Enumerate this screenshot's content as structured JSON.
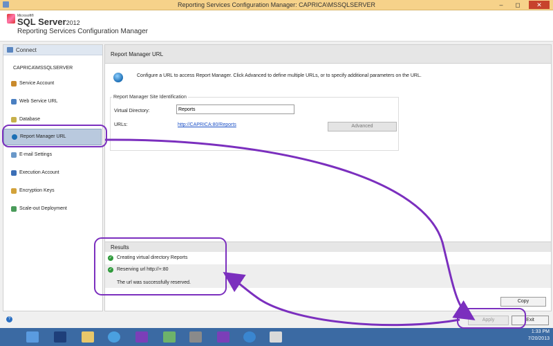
{
  "window": {
    "title": "Reporting Services Configuration Manager: CAPRICA\\MSSQLSERVER",
    "minimize": "–",
    "maximize": "◻",
    "close": "✕"
  },
  "header": {
    "ms_logo": "Microsoft®",
    "sql_server": "SQL Server",
    "sql_version": "2012",
    "product": "Reporting Services Configuration Manager"
  },
  "sidebar": {
    "connect_label": "Connect",
    "instance": "CAPRICA\\MSSQLSERVER",
    "items": [
      {
        "label": "Service Account"
      },
      {
        "label": "Web Service URL"
      },
      {
        "label": "Database"
      },
      {
        "label": "Report Manager URL"
      },
      {
        "label": "E-mail Settings"
      },
      {
        "label": "Execution Account"
      },
      {
        "label": "Encryption Keys"
      },
      {
        "label": "Scale-out Deployment"
      }
    ]
  },
  "main": {
    "title": "Report Manager URL",
    "description": "Configure a URL to access Report Manager. Click Advanced to define multiple URLs, or to specify additional parameters on the URL.",
    "group_label": "Report Manager Site Identification",
    "virtual_directory_label": "Virtual Directory:",
    "virtual_directory_value": "Reports",
    "urls_label": "URLs:",
    "url_value": "http://CAPRICA:80/Reports",
    "advanced_label": "Advanced"
  },
  "results": {
    "title": "Results",
    "rows": [
      {
        "text": "Creating virtual directory Reports"
      },
      {
        "text": "Reserving url http://+:80"
      }
    ],
    "detail": "The url was successfully reserved.",
    "copy_label": "Copy"
  },
  "footer": {
    "help": "?",
    "apply_label": "Apply",
    "exit_label": "Exit"
  },
  "taskbar": {
    "time": "1:33 PM",
    "date": "7/20/2013"
  },
  "colors": {
    "accent_annotation": "#7b2fbe",
    "title_bar": "#f6d28a",
    "taskbar": "#3b6aa3",
    "selected_nav": "#b9c9de",
    "success": "#2f9a3b"
  }
}
